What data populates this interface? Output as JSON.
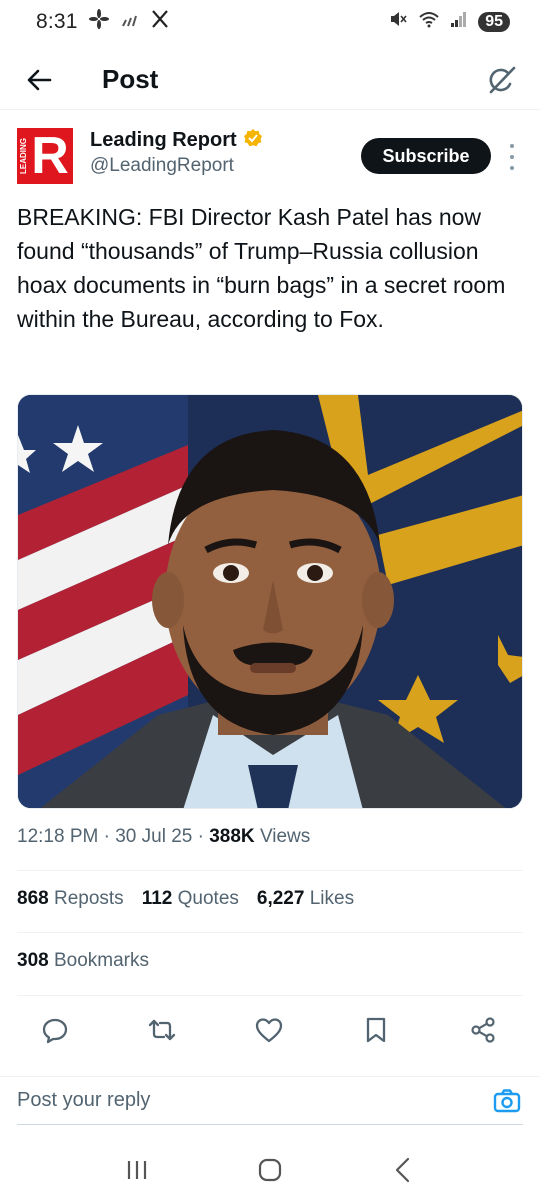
{
  "status_bar": {
    "time": "8:31",
    "battery": "95",
    "left_icons": [
      "fan-icon",
      "signal-bars-icon",
      "x-logo-icon"
    ],
    "right_icons": [
      "mute-icon",
      "wifi-icon",
      "cell-signal-icon",
      "battery-icon"
    ]
  },
  "header": {
    "title": "Post",
    "back_icon": "back-arrow-icon",
    "grok_icon": "grok-icon"
  },
  "post": {
    "author_name": "Leading Report",
    "author_handle": "@LeadingReport",
    "avatar_letter": "R",
    "avatar_tag": "LEADING",
    "verified_badge_color": "#f4b400",
    "subscribe_label": "Subscribe",
    "text": "BREAKING: FBI Director Kash Patel has now found “thousands” of Trump–Russia collusion hoax documents in “burn bags” in a secret room within the Bureau, according to Fox.",
    "time": "12:18 PM",
    "date": "30 Jul 25",
    "views_count": "388K",
    "views_label": "Views"
  },
  "stats": {
    "reposts_count": "868",
    "reposts_label": "Reposts",
    "quotes_count": "112",
    "quotes_label": "Quotes",
    "likes_count": "6,227",
    "likes_label": "Likes",
    "bookmarks_count": "308",
    "bookmarks_label": "Bookmarks"
  },
  "actions": [
    "reply-icon",
    "repost-icon",
    "like-icon",
    "bookmark-icon",
    "share-icon"
  ],
  "reply": {
    "placeholder": "Post your reply"
  },
  "colors": {
    "accent": "#1d9bf0",
    "brand_red": "#e0161e",
    "text_primary": "#0f1419",
    "text_secondary": "#536471"
  }
}
